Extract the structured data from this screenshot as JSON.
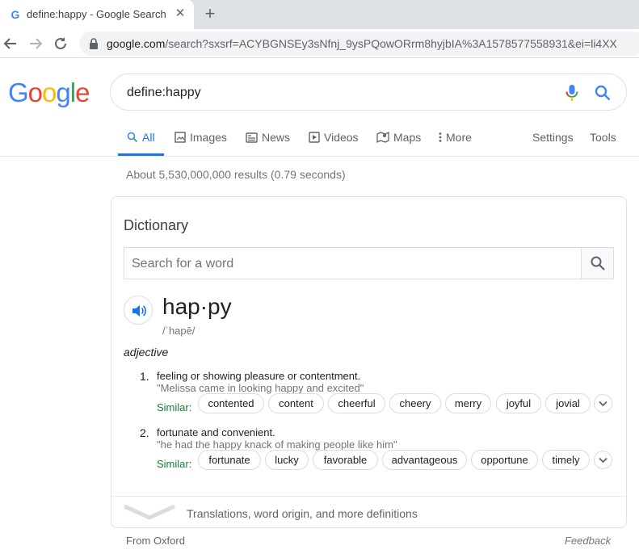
{
  "browser": {
    "tab_title": "define:happy - Google Search",
    "tab_favicon": "G",
    "close_glyph": "✕",
    "newtab_glyph": "+",
    "url_host": "google.com",
    "url_path": "/search?sxsrf=ACYBGNSEy3sNfnj_9ysPQowORrm8hyjbIA%3A1578577558931&ei=li4XX"
  },
  "logo": {
    "letters": [
      "G",
      "o",
      "o",
      "g",
      "l",
      "e"
    ],
    "colors": [
      "#4285f4",
      "#ea4335",
      "#fbbc05",
      "#4285f4",
      "#34a853",
      "#ea4335"
    ]
  },
  "search": {
    "query": "define:happy"
  },
  "nav_tabs": {
    "all": "All",
    "images": "Images",
    "news": "News",
    "videos": "Videos",
    "maps": "Maps",
    "more": "More",
    "settings": "Settings",
    "tools": "Tools"
  },
  "result_stats": "About 5,530,000,000 results (0.79 seconds)",
  "dictionary": {
    "title": "Dictionary",
    "search_placeholder": "Search for a word",
    "headword": "hap·py",
    "phonetic": "/ˈhapē/",
    "part_of_speech": "adjective",
    "senses": [
      {
        "number": "1.",
        "definition": "feeling or showing pleasure or contentment.",
        "example": "\"Melissa came in looking happy and excited\"",
        "similar_label": "Similar:",
        "similar": [
          "contented",
          "content",
          "cheerful",
          "cheery",
          "merry",
          "joyful",
          "jovial"
        ]
      },
      {
        "number": "2.",
        "definition": "fortunate and convenient.",
        "example": "\"he had the happy knack of making people like him\"",
        "similar_label": "Similar:",
        "similar": [
          "fortunate",
          "lucky",
          "favorable",
          "advantageous",
          "opportune",
          "timely"
        ]
      }
    ],
    "more_text": "Translations, word origin, and more definitions"
  },
  "footer": {
    "source": "From Oxford",
    "feedback": "Feedback"
  },
  "colors": {
    "accent_blue": "#1a73e8",
    "similar_green": "#188038",
    "muted_gray": "#70757a"
  }
}
